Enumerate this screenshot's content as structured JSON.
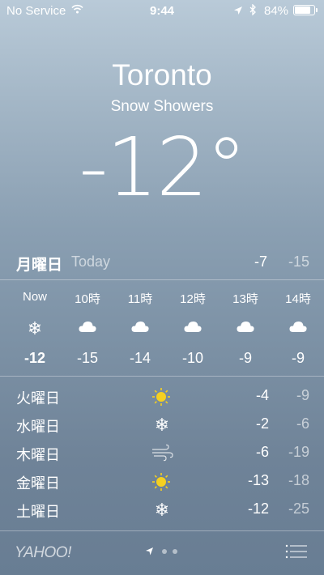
{
  "status_bar": {
    "carrier": "No Service",
    "time": "9:44",
    "battery": "84%",
    "battery_level": 0.84
  },
  "location": {
    "city": "Toronto",
    "condition": "Snow Showers",
    "temperature": "-12°"
  },
  "today": {
    "day": "月曜日",
    "label": "Today",
    "high": "-7",
    "low": "-15"
  },
  "hourly": [
    {
      "time": "Now",
      "icon": "snow-icon",
      "temp": "-12"
    },
    {
      "time": "10時",
      "icon": "cloud-icon",
      "temp": "-15"
    },
    {
      "time": "11時",
      "icon": "cloud-icon",
      "temp": "-14"
    },
    {
      "time": "12時",
      "icon": "cloud-icon",
      "temp": "-10"
    },
    {
      "time": "13時",
      "icon": "cloud-icon",
      "temp": "-9"
    },
    {
      "time": "14時",
      "icon": "cloud-icon",
      "temp": "-9"
    }
  ],
  "daily": [
    {
      "day": "火曜日",
      "icon": "sun-icon",
      "high": "-4",
      "low": "-9"
    },
    {
      "day": "水曜日",
      "icon": "snow-icon",
      "high": "-2",
      "low": "-6"
    },
    {
      "day": "木曜日",
      "icon": "wind-icon",
      "high": "-6",
      "low": "-19"
    },
    {
      "day": "金曜日",
      "icon": "sun-icon",
      "high": "-13",
      "low": "-18"
    },
    {
      "day": "土曜日",
      "icon": "snow-icon",
      "high": "-12",
      "low": "-25"
    }
  ],
  "footer": {
    "brand": "YAHOO!",
    "page_count": 2,
    "current_page": 1
  },
  "colors": {
    "sun": "#f5d020",
    "text": "#ffffff"
  }
}
